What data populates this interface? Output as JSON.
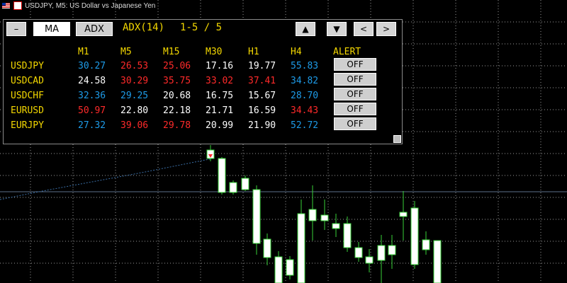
{
  "window": {
    "title": "USDJPY, M5:  US Dollar vs Japanese Yen"
  },
  "panel": {
    "minimize_label": "–",
    "tabs": [
      {
        "label": "MA"
      },
      {
        "label": "ADX"
      }
    ],
    "indicator": "ADX(14)",
    "page": "1-5 / 5",
    "nav": {
      "up": "▲",
      "down": "▼",
      "prev": "<",
      "next": ">"
    },
    "columns": [
      "M1",
      "M5",
      "M15",
      "M30",
      "H1",
      "H4",
      "ALERT"
    ],
    "rows": [
      {
        "symbol": "USDJPY",
        "alert": "OFF",
        "values": [
          {
            "v": "30.27",
            "c": "#1e9be8"
          },
          {
            "v": "26.53",
            "c": "#ff2a2a"
          },
          {
            "v": "25.06",
            "c": "#ff2a2a"
          },
          {
            "v": "17.16",
            "c": "#ffffff"
          },
          {
            "v": "19.77",
            "c": "#ffffff"
          },
          {
            "v": "55.83",
            "c": "#1e9be8"
          }
        ]
      },
      {
        "symbol": "USDCAD",
        "alert": "OFF",
        "values": [
          {
            "v": "24.58",
            "c": "#ffffff"
          },
          {
            "v": "30.29",
            "c": "#ff2a2a"
          },
          {
            "v": "35.75",
            "c": "#ff2a2a"
          },
          {
            "v": "33.02",
            "c": "#ff2a2a"
          },
          {
            "v": "37.41",
            "c": "#ff2a2a"
          },
          {
            "v": "34.82",
            "c": "#1e9be8"
          }
        ]
      },
      {
        "symbol": "USDCHF",
        "alert": "OFF",
        "values": [
          {
            "v": "32.36",
            "c": "#1e9be8"
          },
          {
            "v": "29.25",
            "c": "#1e9be8"
          },
          {
            "v": "20.68",
            "c": "#ffffff"
          },
          {
            "v": "16.75",
            "c": "#ffffff"
          },
          {
            "v": "15.67",
            "c": "#ffffff"
          },
          {
            "v": "28.70",
            "c": "#1e9be8"
          }
        ]
      },
      {
        "symbol": "EURUSD",
        "alert": "OFF",
        "values": [
          {
            "v": "50.97",
            "c": "#ff2a2a"
          },
          {
            "v": "22.80",
            "c": "#ffffff"
          },
          {
            "v": "22.18",
            "c": "#ffffff"
          },
          {
            "v": "21.71",
            "c": "#ffffff"
          },
          {
            "v": "16.59",
            "c": "#ffffff"
          },
          {
            "v": "34.43",
            "c": "#ff2a2a"
          }
        ]
      },
      {
        "symbol": "EURJPY",
        "alert": "OFF",
        "values": [
          {
            "v": "27.32",
            "c": "#1e9be8"
          },
          {
            "v": "39.06",
            "c": "#ff2a2a"
          },
          {
            "v": "29.78",
            "c": "#ff2a2a"
          },
          {
            "v": "20.99",
            "c": "#ffffff"
          },
          {
            "v": "21.90",
            "c": "#ffffff"
          },
          {
            "v": "52.72",
            "c": "#1e9be8"
          }
        ]
      }
    ]
  },
  "colors": {
    "header": "#f4d800",
    "bull": "#1e9be8",
    "bear": "#ff2a2a",
    "neutral": "#ffffff"
  }
}
